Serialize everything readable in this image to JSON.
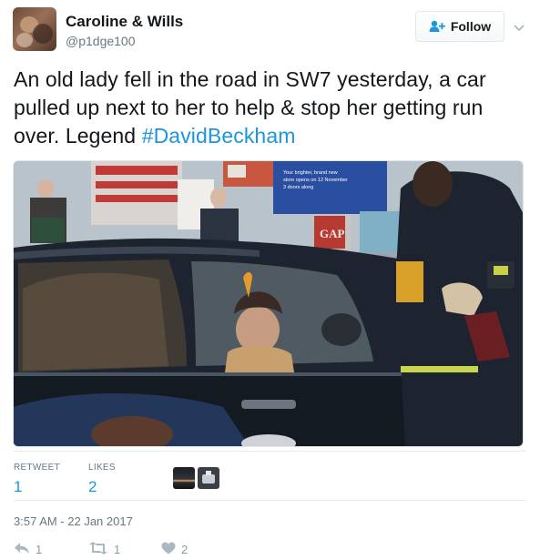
{
  "user": {
    "display_name": "Caroline & Wills",
    "handle": "@p1dge100",
    "avatar_icon": "profile-photo"
  },
  "follow_button": {
    "label": "Follow",
    "icon": "add-user-icon"
  },
  "tweet": {
    "text": "An old lady fell in the road in SW7 yesterday, a car pulled up next to her to help & stop her getting run over. Legend ",
    "hashtag": "#DavidBeckham"
  },
  "photo": {
    "shop_sign": "GAP",
    "window_poster_lines": [
      "Your brighter, brand new",
      "store opens on 12 November",
      "3 doors along"
    ]
  },
  "stats": {
    "retweet_label": "RETWEET",
    "retweet_count": "1",
    "likes_label": "LIKES",
    "likes_count": "2"
  },
  "timestamp": "3:57 AM - 22 Jan 2017",
  "actions": {
    "reply_count": "1",
    "retweet_count": "1",
    "like_count": "2"
  },
  "colors": {
    "link": "#1b95e0",
    "secondary_text": "#657786",
    "action_icon": "#aab8c2"
  }
}
